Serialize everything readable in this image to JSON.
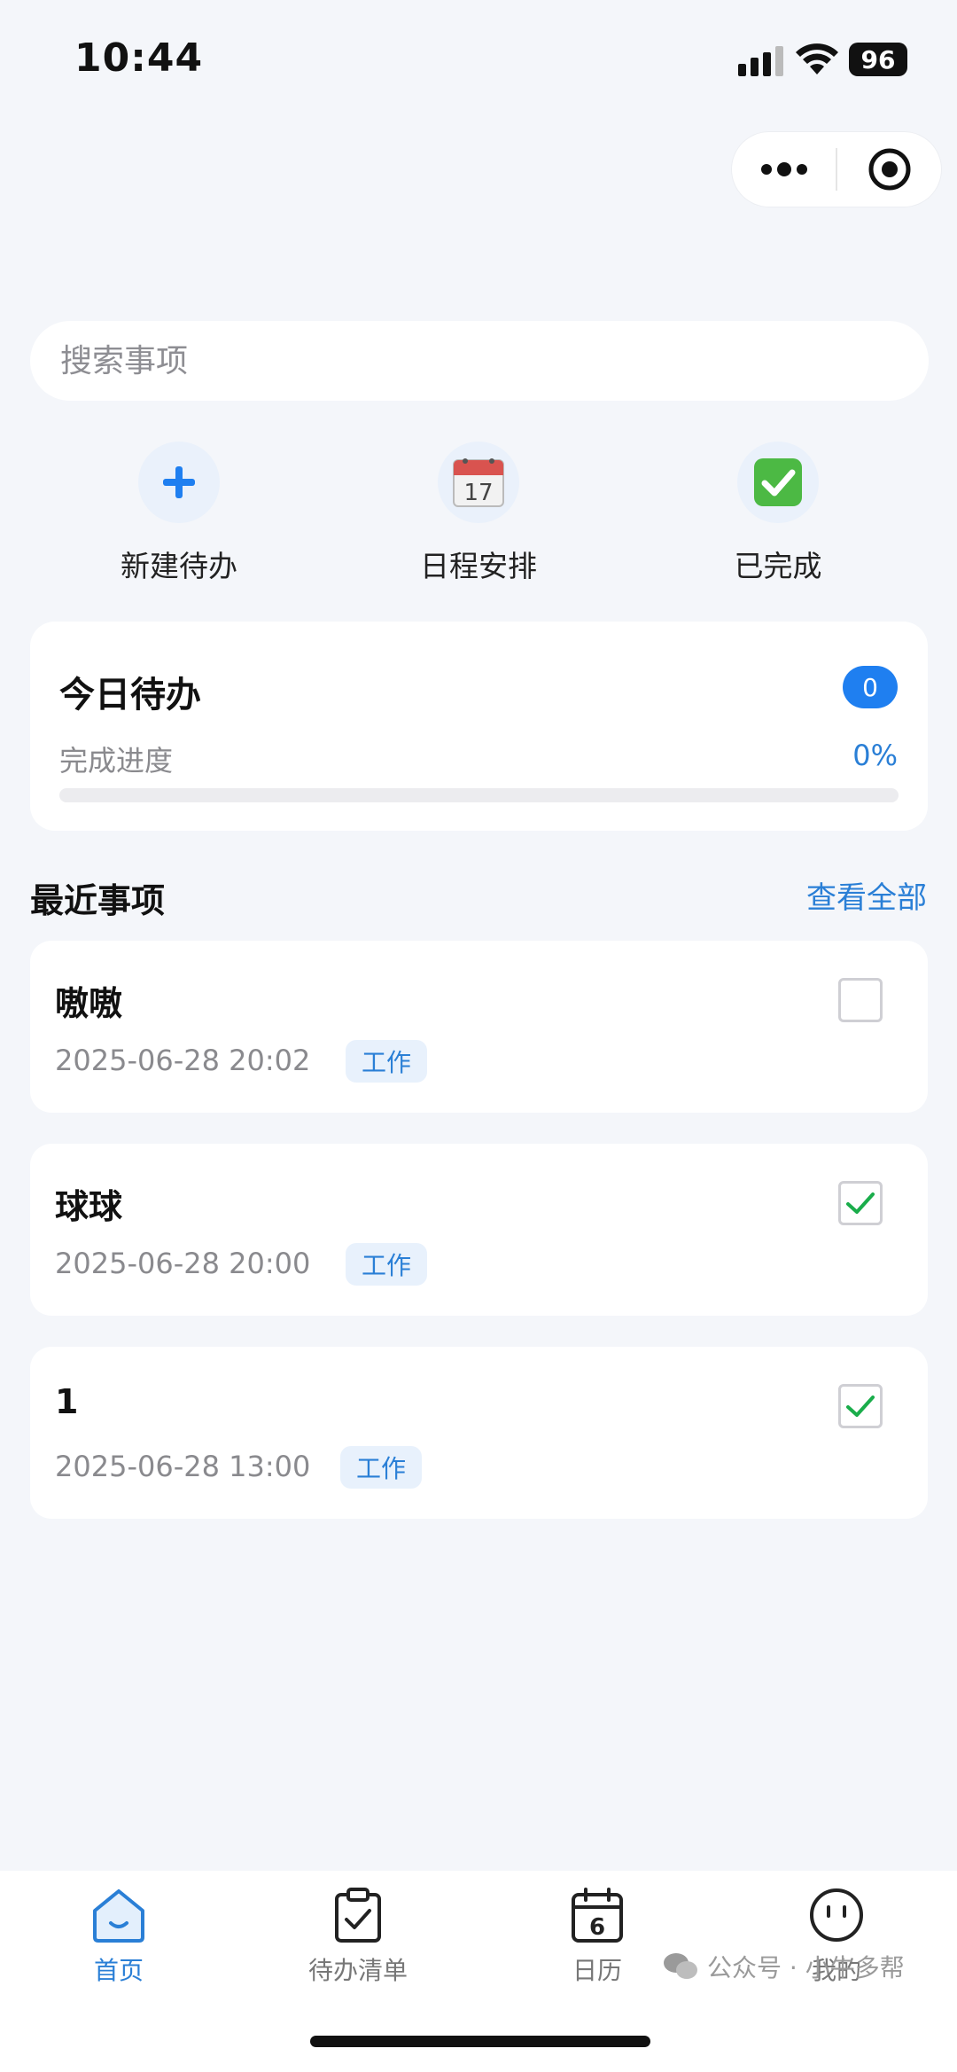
{
  "status_bar": {
    "time": "10:44",
    "battery": "96"
  },
  "search": {
    "placeholder": "搜索事项"
  },
  "quick_actions": [
    {
      "label": "新建待办",
      "icon": "plus-icon"
    },
    {
      "label": "日程安排",
      "icon": "calendar-icon"
    },
    {
      "label": "已完成",
      "icon": "check-mark-button-icon"
    }
  ],
  "today": {
    "title": "今日待办",
    "count": "0",
    "progress_label": "完成进度",
    "progress_text": "0%",
    "progress_value": 0
  },
  "recent": {
    "title": "最近事项",
    "view_all": "查看全部",
    "items": [
      {
        "title": "嗷嗷",
        "datetime": "2025-06-28 20:02",
        "tag": "工作",
        "done": false
      },
      {
        "title": "球球",
        "datetime": "2025-06-28 20:00",
        "tag": "工作",
        "done": true
      },
      {
        "title": "1",
        "datetime": "2025-06-28 13:00",
        "tag": "工作",
        "done": true
      }
    ]
  },
  "tabs": [
    {
      "label": "首页",
      "icon": "home-icon",
      "active": true
    },
    {
      "label": "待办清单",
      "icon": "clipboard-check-icon",
      "active": false
    },
    {
      "label": "日历",
      "icon": "calendar-icon",
      "active": false,
      "icon_text": "6"
    },
    {
      "label": "我的",
      "icon": "face-icon",
      "active": false
    }
  ],
  "watermark": "公众号 · 小牛多帮",
  "colors": {
    "accent": "#1f7ff0",
    "link": "#2a7fd6",
    "background": "#f4f6fa",
    "check": "#1aad4b"
  }
}
